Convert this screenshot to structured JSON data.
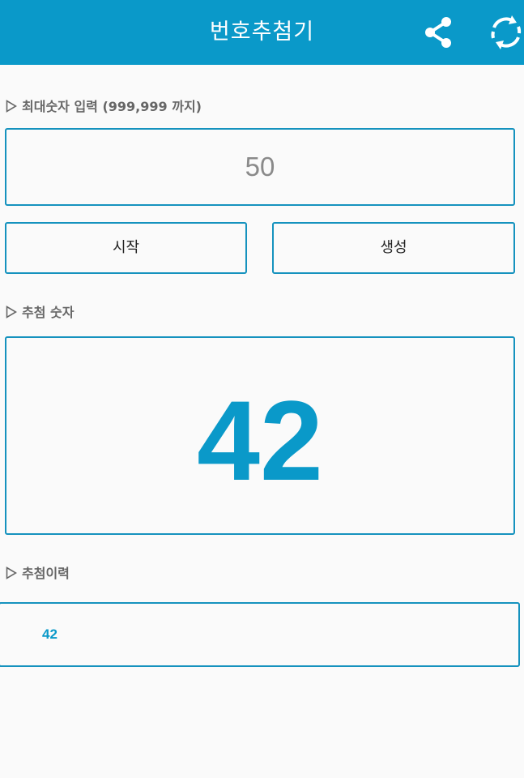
{
  "appbar": {
    "title": "번호추첨기",
    "share_icon": "share-icon",
    "refresh_icon": "refresh-icon",
    "background": "#0a99c9"
  },
  "max_section": {
    "label": "최대숫자 입력 (999,999 까지)",
    "input_value": "50"
  },
  "buttons": {
    "start_label": "시작",
    "generate_label": "생성"
  },
  "result_section": {
    "label": "추첨 숫자",
    "number": "42"
  },
  "history_section": {
    "label": "추첨이력",
    "items": [
      "42"
    ]
  },
  "colors": {
    "accent": "#0a99c9",
    "border": "#1592be",
    "label": "#666666"
  }
}
